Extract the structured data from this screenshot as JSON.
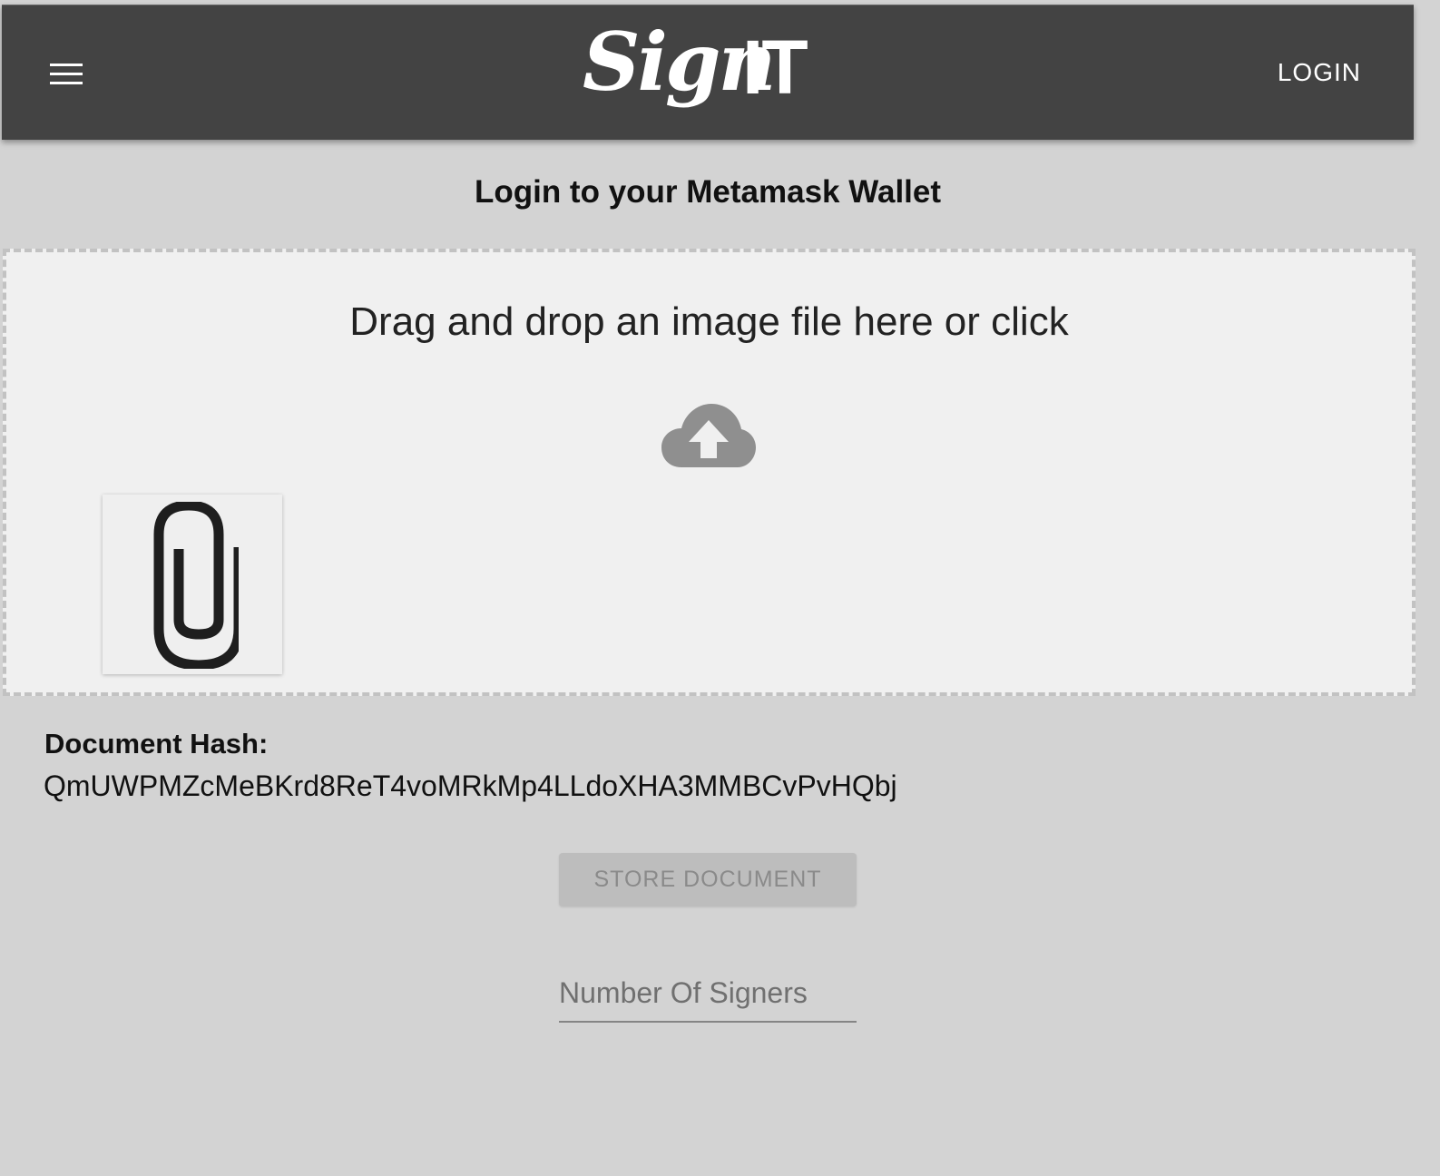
{
  "header": {
    "logo_script": "Sign",
    "logo_block": "IT",
    "login_label": "LOGIN",
    "menu_icon": "hamburger-menu-icon",
    "background": "#434343"
  },
  "main": {
    "title": "Login to your Metamask Wallet",
    "dropzone": {
      "text": "Drag and drop an image file here or click",
      "upload_icon": "cloud-upload-icon",
      "attachment_icon": "paperclip-icon"
    },
    "hash": {
      "label": "Document Hash:",
      "value": "QmUWPMZcMeBKrd8ReT4voMRkMp4LLdoXHA3MMBCvPvHQbj"
    },
    "store_button_label": "STORE DOCUMENT",
    "signers_input": {
      "placeholder": "Number Of Signers",
      "value": ""
    }
  },
  "colors": {
    "page_background": "#d3d3d3",
    "dropzone_background": "#f0f0f0",
    "disabled_button": "#bdbdbd"
  }
}
